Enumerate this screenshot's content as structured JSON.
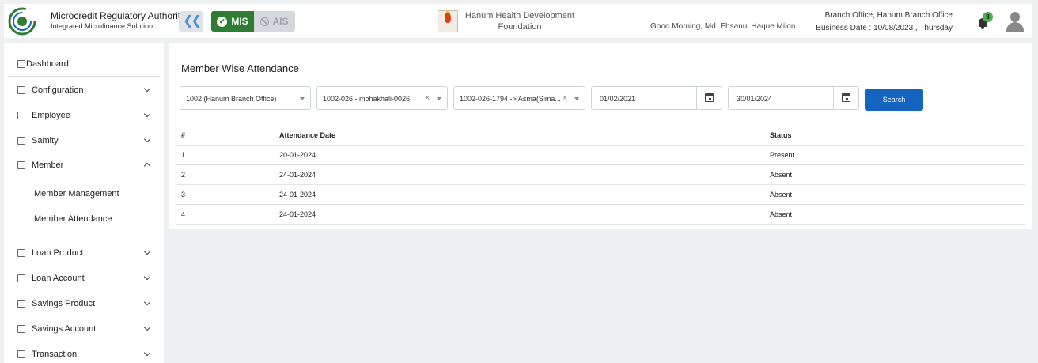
{
  "header": {
    "org_name": "Microcredit Regulatory Authority",
    "org_subtitle": "Integrated Microfinance Solution",
    "logo_text": "Microcredit Regulatory Authority",
    "collapse_icon": "double-chevron-left-icon",
    "switch": {
      "mis_label": "MIS",
      "ais_label": "AIS",
      "active": "MIS"
    },
    "foundation_name": "Hanum Health Development Foundation",
    "greeting": "Good Morning, Md. Ehsanul Haque Milon",
    "branch": "Branch Office, Hanum Branch Office",
    "business_date": "Business Date : 10/08/2023 , Thursday",
    "notification_count": "8"
  },
  "sidebar": {
    "items": [
      {
        "label": "Dashboard",
        "icon": "dashboard-icon"
      },
      {
        "label": "Configuration",
        "icon": "configuration-icon",
        "expanded": false
      },
      {
        "label": "Employee",
        "icon": "employee-icon",
        "expanded": false
      },
      {
        "label": "Samity",
        "icon": "samity-icon",
        "expanded": false
      },
      {
        "label": "Member",
        "icon": "member-icon",
        "expanded": true
      },
      {
        "label": "Loan Product",
        "icon": "loan-product-icon",
        "expanded": false
      },
      {
        "label": "Loan Account",
        "icon": "loan-account-icon",
        "expanded": false
      },
      {
        "label": "Savings Product",
        "icon": "savings-product-icon",
        "expanded": false
      },
      {
        "label": "Savings Account",
        "icon": "savings-account-icon",
        "expanded": false
      },
      {
        "label": "Transaction",
        "icon": "transaction-icon",
        "expanded": false
      }
    ],
    "member_sub": [
      {
        "label": "Member Management"
      },
      {
        "label": "Member Attendance"
      }
    ]
  },
  "main": {
    "title": "Member Wise Attendance",
    "filters": {
      "branch": "1002 (Hanum Branch Office)",
      "samity": "1002-026 - mohakhali-0026",
      "member": "1002-026-1794 -> Asma(Sima...",
      "from_date": "01/02/2021",
      "to_date": "30/01/2024"
    },
    "search_label": "Search",
    "table": {
      "headers": [
        "#",
        "Attendance Date",
        "Status"
      ],
      "rows": [
        [
          "1",
          "20-01-2024",
          "Present"
        ],
        [
          "2",
          "24-01-2024",
          "Absent"
        ],
        [
          "3",
          "24-01-2024",
          "Absent"
        ],
        [
          "4",
          "24-01-2024",
          "Absent"
        ]
      ]
    }
  },
  "colors": {
    "mis_active": "#2e7d32",
    "search_button": "#1565c0",
    "badge": "#4caf50"
  }
}
